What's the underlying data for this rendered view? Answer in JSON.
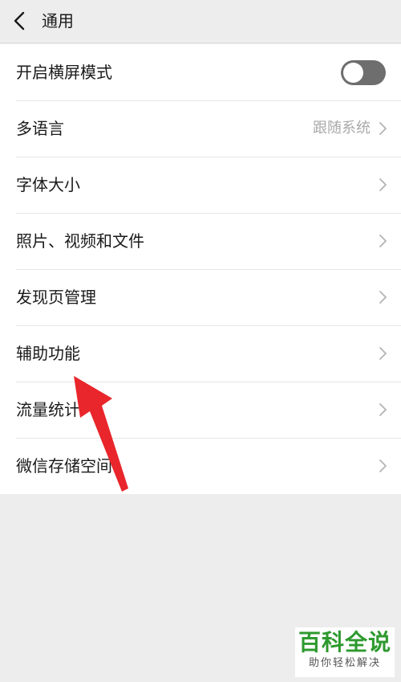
{
  "nav": {
    "title": "通用",
    "back_icon": "chevron-left-icon"
  },
  "settings": [
    {
      "label": "开启横屏模式",
      "control": "toggle",
      "toggle_on": false
    },
    {
      "label": "多语言",
      "control": "chevron",
      "value": "跟随系统"
    },
    {
      "label": "字体大小",
      "control": "chevron"
    },
    {
      "label": "照片、视频和文件",
      "control": "chevron"
    },
    {
      "label": "发现页管理",
      "control": "chevron"
    },
    {
      "label": "辅助功能",
      "control": "chevron"
    },
    {
      "label": "流量统计",
      "control": "chevron"
    },
    {
      "label": "微信存储空间",
      "control": "chevron"
    }
  ],
  "colors": {
    "background": "#ededed",
    "list_bg": "#ffffff",
    "toggle_off": "#6e6e6e",
    "annotation_arrow": "#e8262b",
    "watermark_green": "#2e9a2e"
  },
  "watermark": {
    "brand": "百科全说",
    "tagline": "助你轻松解决"
  }
}
